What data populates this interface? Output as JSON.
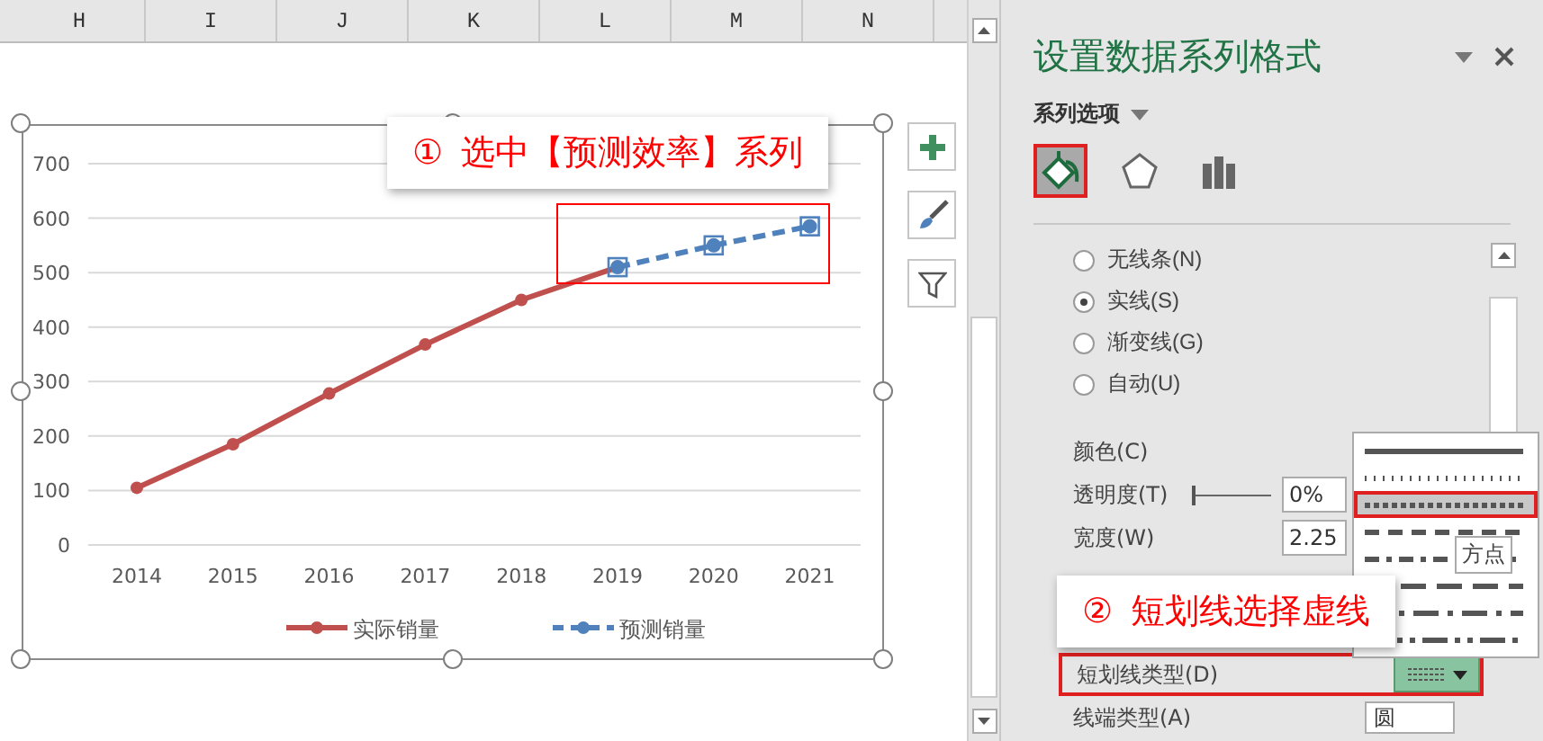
{
  "columns": [
    "H",
    "I",
    "J",
    "K",
    "L",
    "M",
    "N"
  ],
  "chart": {
    "chart_data": {
      "type": "line",
      "categories": [
        "2014",
        "2015",
        "2016",
        "2017",
        "2018",
        "2019",
        "2020",
        "2021"
      ],
      "ylim": [
        0,
        700
      ],
      "yticks": [
        0,
        100,
        200,
        300,
        400,
        500,
        600,
        700
      ],
      "grid": true,
      "legend": true,
      "series": [
        {
          "name": "实际销量",
          "color": "#c0504d",
          "marker": "circle",
          "line_style": "solid",
          "values": [
            105,
            185,
            278,
            368,
            450,
            510,
            null,
            null
          ]
        },
        {
          "name": "预测销量",
          "color": "#4f81bd",
          "marker": "circle",
          "line_style": "dashed",
          "values": [
            null,
            null,
            null,
            null,
            null,
            510,
            550,
            585
          ]
        }
      ]
    }
  },
  "callouts": [
    {
      "number": "①",
      "text": "选中【预测效率】系列"
    },
    {
      "number": "②",
      "text": "短划线选择虚线"
    }
  ],
  "panel": {
    "title": "设置数据系列格式",
    "section": "系列选项",
    "tabs": [
      {
        "kind": "fill",
        "selected": true
      },
      {
        "kind": "effects",
        "selected": false
      },
      {
        "kind": "options",
        "selected": false
      }
    ],
    "line_options": [
      {
        "label": "无线条(N)",
        "selected": false
      },
      {
        "label": "实线(S)",
        "selected": true
      },
      {
        "label": "渐变线(G)",
        "selected": false
      },
      {
        "label": "自动(U)",
        "selected": false
      }
    ],
    "color_label": "颜色(C)",
    "transparency": {
      "label": "透明度(T)",
      "value": "0%",
      "level": 0
    },
    "width": {
      "label": "宽度(W)",
      "value": "2.25"
    },
    "dash_type": {
      "label": "短划线类型(D)"
    },
    "cap_type": {
      "label": "线端类型(A)",
      "value": "圆"
    },
    "dash_menu": {
      "tooltip": "方点",
      "options": [
        {
          "kind": "solid",
          "selected": false
        },
        {
          "kind": "round-dot",
          "selected": false
        },
        {
          "kind": "square-dot",
          "selected": true
        },
        {
          "kind": "dash",
          "selected": false
        },
        {
          "kind": "dash-dot",
          "selected": false
        },
        {
          "kind": "long-dash",
          "selected": false
        },
        {
          "kind": "long-dash-dot",
          "selected": false
        },
        {
          "kind": "long-dash-dot-dot",
          "selected": false
        }
      ]
    }
  }
}
